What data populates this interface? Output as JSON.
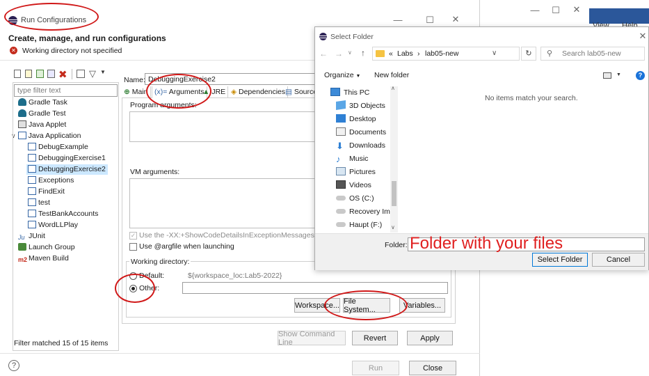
{
  "run_config": {
    "title": "Run Configurations",
    "heading": "Create, manage, and run configurations",
    "error_message": "Working directory not specified",
    "filter_placeholder": "type filter text",
    "filter_status": "Filter matched 15 of 15 items",
    "tree": [
      {
        "label": "Gradle Task",
        "depth": 1
      },
      {
        "label": "Gradle Test",
        "depth": 1
      },
      {
        "label": "Java Applet",
        "depth": 1
      },
      {
        "label": "Java Application",
        "depth": 0,
        "expanded": true
      },
      {
        "label": "DebugExample",
        "depth": 2
      },
      {
        "label": "DebuggingExercise1",
        "depth": 2
      },
      {
        "label": "DebuggingExercise2",
        "depth": 2,
        "selected": true
      },
      {
        "label": "Exceptions",
        "depth": 2
      },
      {
        "label": "FindExit",
        "depth": 2
      },
      {
        "label": "test",
        "depth": 2
      },
      {
        "label": "TestBankAccounts",
        "depth": 2
      },
      {
        "label": "WordLLPlay",
        "depth": 2
      },
      {
        "label": "JUnit",
        "depth": 1
      },
      {
        "label": "Launch Group",
        "depth": 1
      },
      {
        "label": "Maven Build",
        "depth": 1
      }
    ],
    "name_label": "Name:",
    "name_value": "DebuggingExercise2",
    "tabs": [
      "Main",
      "Arguments",
      "JRE",
      "Dependencies",
      "Source"
    ],
    "program_args_label": "Program arguments:",
    "vm_args_label": "VM arguments:",
    "show_code_details": "Use the -XX:+ShowCodeDetailsInExceptionMessages argume",
    "use_argfile": "Use @argfile when launching",
    "working_dir_label": "Working directory:",
    "default_label": "Default:",
    "default_value": "${workspace_loc:Lab5-2022}",
    "other_label": "Other:",
    "workspace_button": "Workspace...",
    "filesystem_button": "File System...",
    "variables_button": "Variables...",
    "show_cmd_button": "Show Command Line",
    "revert_button": "Revert",
    "apply_button": "Apply",
    "run_button": "Run",
    "close_button": "Close"
  },
  "bg_window": {
    "menu_view": "View",
    "menu_help": "Help"
  },
  "select_folder": {
    "title": "Select Folder",
    "breadcrumb_prefix": "«",
    "breadcrumb": [
      "Labs",
      "lab05-new"
    ],
    "search_placeholder": "Search lab05-new",
    "organize": "Organize",
    "new_folder": "New folder",
    "empty_message": "No items match your search.",
    "nav": [
      {
        "label": "This PC",
        "icon": "pc-icon"
      },
      {
        "label": "3D Objects",
        "icon": "cube-icon"
      },
      {
        "label": "Desktop",
        "icon": "desktop-icon"
      },
      {
        "label": "Documents",
        "icon": "document-icon"
      },
      {
        "label": "Downloads",
        "icon": "download-icon"
      },
      {
        "label": "Music",
        "icon": "music-icon"
      },
      {
        "label": "Pictures",
        "icon": "pictures-icon"
      },
      {
        "label": "Videos",
        "icon": "video-icon"
      },
      {
        "label": "OS (C:)",
        "icon": "drive-icon"
      },
      {
        "label": "Recovery Imag",
        "icon": "drive-icon"
      },
      {
        "label": "Haupt (F:)",
        "icon": "drive-icon"
      }
    ],
    "folder_label": "Folder:",
    "folder_value": "Folder with your files",
    "select_button": "Select Folder",
    "cancel_button": "Cancel"
  },
  "colors": {
    "annotation_red": "#d01818",
    "folder_text_red": "#e02020",
    "selection_blue": "#cce8ff",
    "error_red": "#c42b1c"
  }
}
